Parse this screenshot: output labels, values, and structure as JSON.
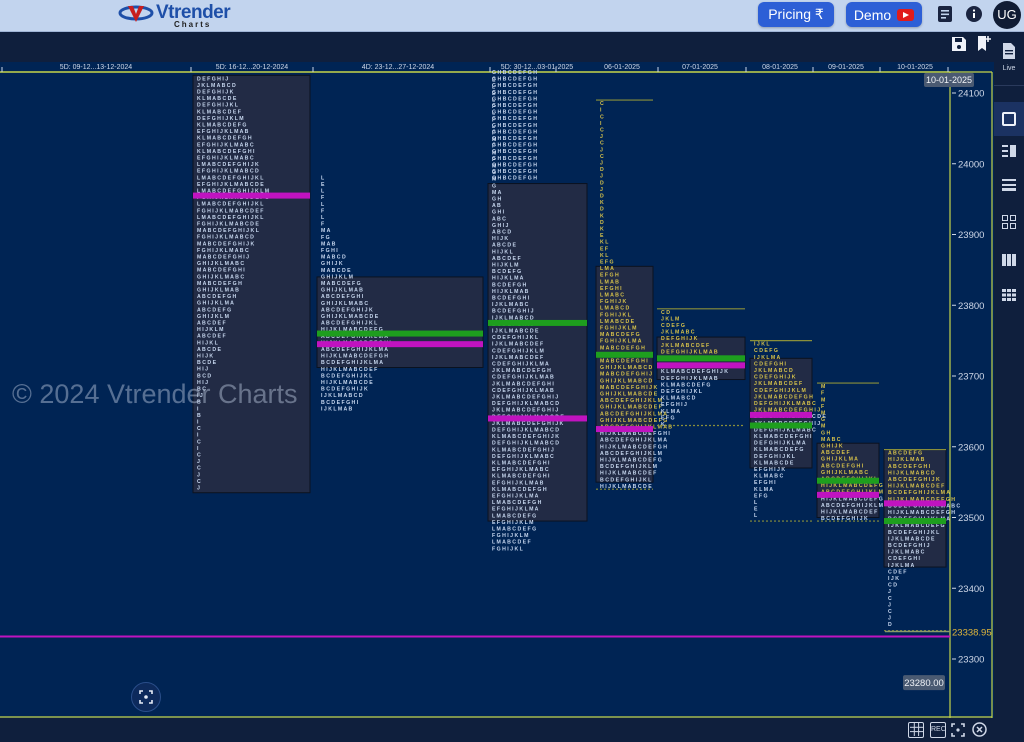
{
  "header": {
    "logo_brand": "Vtrender",
    "logo_sub": "Charts",
    "pricing_label": "Pricing ₹",
    "demo_label": "Demo",
    "avatar_initials": "UG"
  },
  "toolbar": {
    "save_icon": "save-icon",
    "bookmark_icon": "bookmark-add-icon"
  },
  "right_panel": {
    "live_label": "Live",
    "items": [
      "document-icon",
      "single-layout-icon",
      "split-layout-icon",
      "rows-layout-icon",
      "grid-2x2-icon",
      "columns-layout-icon",
      "grid-3x3-icon"
    ]
  },
  "watermark": "© 2024 Vtrender Charts",
  "bottom_toolbar": {
    "items": [
      "grid-icon",
      "rec-icon",
      "fullscreen-icon",
      "close-circle-icon"
    ],
    "rec_label": "REC"
  },
  "chart_data": {
    "type": "market-profile",
    "title": "",
    "ylabel": "",
    "xlabel": "",
    "ylim": [
      23250,
      24125
    ],
    "y_ticks": [
      24100,
      24000,
      23900,
      23800,
      23700,
      23600,
      23500,
      23400,
      23300
    ],
    "x_labels": [
      "5D: 09-12...13-12-2024",
      "5D: 16-12...20-12-2024",
      "4D: 23-12...27-12-2024",
      "5D: 30-12...03-01-2025",
      "06-01-2025",
      "07-01-2025",
      "08-01-2025",
      "09-01-2025",
      "10-01-2025"
    ],
    "current_date_label": "10-01-2025",
    "last_price_label": "23338.95",
    "cursor_price_label": "23280.00",
    "colors": {
      "poc": "#c013c0",
      "vwap": "#1e9e1e",
      "value_area": "#222b45",
      "letters": "#c8d8f0",
      "ib_letters": "#d8c34a",
      "last_price": "#e0b63a",
      "axis_border": "#c5d54a"
    },
    "profiles": [
      {
        "label": "5D: 16-12...20-12-2024",
        "high": 24125,
        "low": 23535,
        "va_high": 24125,
        "va_low": 23535,
        "poc": 23955,
        "vwap": null
      },
      {
        "label": "4D: 23-12...27-12-2024",
        "high": 23985,
        "low": 23650,
        "va_high": 23840,
        "va_low": 23712,
        "poc": 23745,
        "vwap": 23760
      },
      {
        "label": "5D: 30-12...03-01-2025",
        "high": 24123,
        "low": 23450,
        "va_high": 23972,
        "va_low": 23495,
        "poc": 23640,
        "vwap": 23775
      },
      {
        "label": "06-01-2025",
        "high": 24090,
        "low": 23540,
        "va_high": 23855,
        "va_low": 23550,
        "poc": 23625,
        "vwap": 23730
      },
      {
        "label": "07-01-2025",
        "high": 23795,
        "low": 23630,
        "va_high": 23755,
        "va_low": 23695,
        "poc": 23715,
        "vwap": 23725
      },
      {
        "label": "08-01-2025",
        "high": 23750,
        "low": 23495,
        "va_high": 23725,
        "va_low": 23570,
        "poc": 23645,
        "vwap": 23630
      },
      {
        "label": "09-01-2025",
        "high": 23690,
        "low": 23495,
        "va_high": 23605,
        "va_low": 23500,
        "poc": 23532,
        "vwap": 23552
      },
      {
        "label": "10-01-2025",
        "high": 23596,
        "low": 23340,
        "va_high": 23596,
        "va_low": 23430,
        "poc": 23520,
        "vwap": 23495
      }
    ]
  }
}
